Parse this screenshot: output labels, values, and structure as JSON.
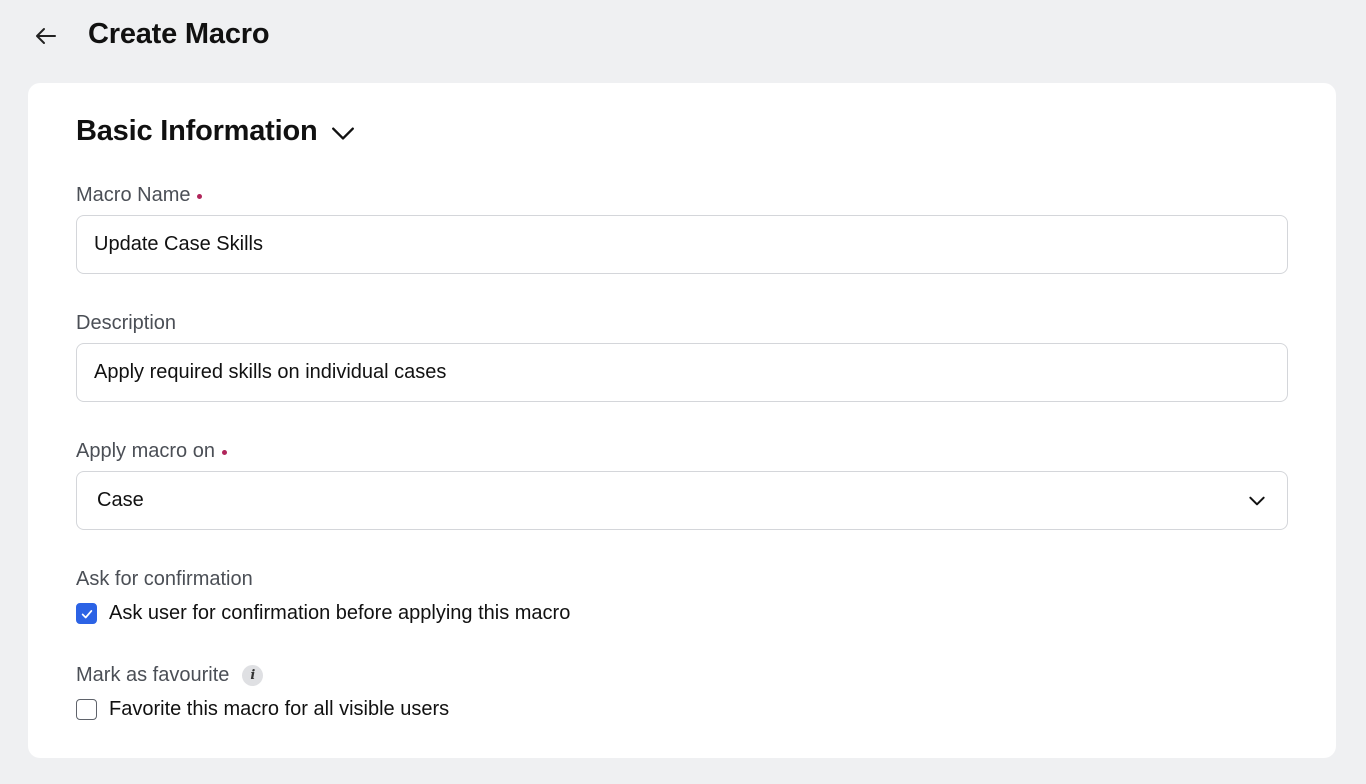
{
  "header": {
    "title": "Create Macro",
    "back_icon": "arrow-left-icon"
  },
  "section": {
    "title": "Basic Information",
    "toggle_icon": "chevron-down-icon"
  },
  "fields": {
    "macro_name": {
      "label": "Macro Name",
      "required": true,
      "value": "Update Case Skills"
    },
    "description": {
      "label": "Description",
      "required": false,
      "value": "Apply required skills on individual cases"
    },
    "apply_on": {
      "label": "Apply macro on",
      "required": true,
      "selected": "Case"
    },
    "confirmation": {
      "label": "Ask for confirmation",
      "checkbox_label": "Ask user for confirmation before applying this macro",
      "checked": true
    },
    "favourite": {
      "label": "Mark as favourite",
      "info_icon": "info-icon",
      "checkbox_label": "Favorite this macro for all visible users",
      "checked": false
    }
  },
  "colors": {
    "page_background": "#eff0f2",
    "card_background": "#ffffff",
    "required_marker": "#b0255a",
    "checkbox_accent": "#2c63e5",
    "input_border": "#d4d6da",
    "label_text": "#4b4f56"
  }
}
